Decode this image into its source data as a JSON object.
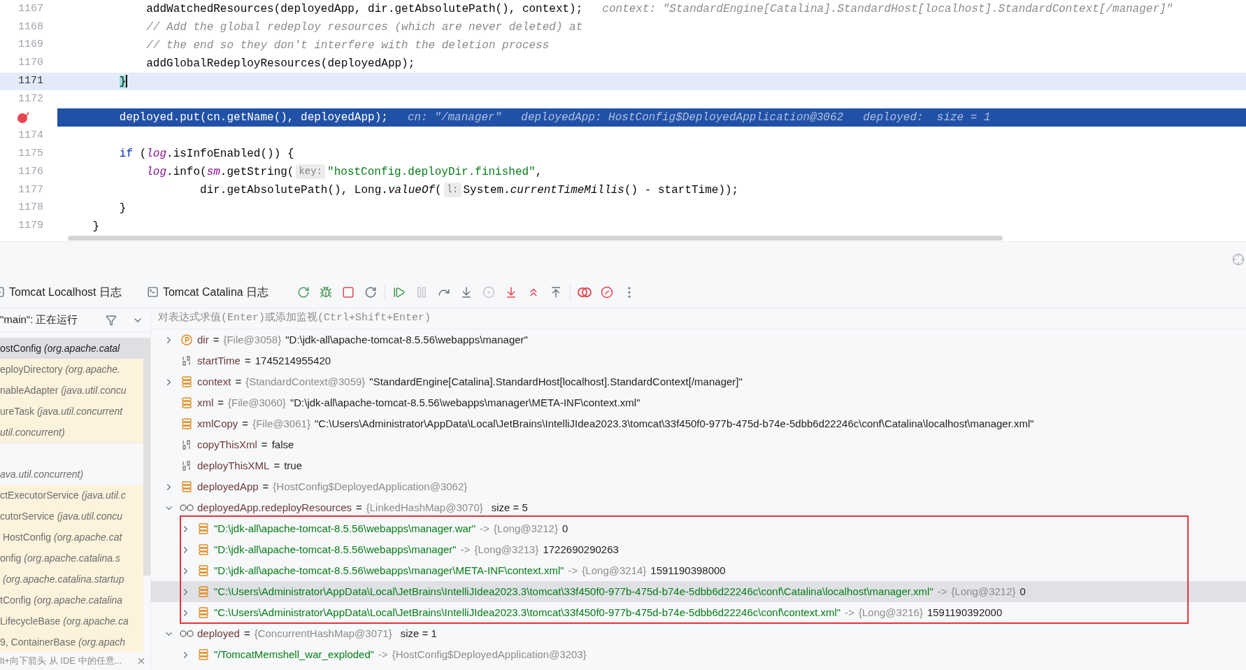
{
  "editor": {
    "lines": [
      {
        "number": "1167",
        "caret": false,
        "execution": false,
        "breakpoint": false,
        "segments": [
          {
            "kind": "plain",
            "text": "            addWatchedResources(deployedApp, dir.getAbsolutePath(), context);"
          },
          {
            "kind": "inline",
            "text": "context: \"StandardEngine[Catalina].StandardHost[localhost].StandardContext[/manager]\""
          }
        ]
      },
      {
        "number": "1168",
        "caret": false,
        "execution": false,
        "breakpoint": false,
        "segments": [
          {
            "kind": "comment",
            "text": "            // Add the global redeploy resources (which are never deleted) at"
          }
        ]
      },
      {
        "number": "1169",
        "caret": false,
        "execution": false,
        "breakpoint": false,
        "segments": [
          {
            "kind": "comment",
            "text": "            // the end so they don't interfere with the deletion process"
          }
        ]
      },
      {
        "number": "1170",
        "caret": false,
        "execution": false,
        "breakpoint": false,
        "segments": [
          {
            "kind": "plain",
            "text": "            addGlobalRedeployResources(deployedApp);"
          }
        ]
      },
      {
        "number": "1171",
        "caret": true,
        "execution": false,
        "breakpoint": false,
        "segments": [
          {
            "kind": "matched",
            "text": "        }"
          }
        ]
      },
      {
        "number": "1172",
        "caret": false,
        "execution": false,
        "breakpoint": false
      },
      {
        "caret": false,
        "execution": true,
        "breakpoint": true,
        "segments": [
          {
            "kind": "plain",
            "text": "        deployed.put(cn.getName(), deployedApp);"
          },
          {
            "kind": "inline",
            "text": "cn: \"/manager\""
          },
          {
            "kind": "inline",
            "text": "deployedApp: HostConfig$DeployedApplication@3062"
          },
          {
            "kind": "inline",
            "text": "deployed:  size = 1"
          }
        ]
      },
      {
        "number": "1174",
        "caret": false,
        "execution": false,
        "breakpoint": false
      },
      {
        "number": "1175",
        "caret": false,
        "execution": false,
        "breakpoint": false,
        "segments": [
          {
            "kind": "keyword",
            "text": "        if"
          },
          {
            "kind": "plain",
            "text": " ("
          },
          {
            "kind": "field",
            "text": "log"
          },
          {
            "kind": "plain",
            "text": ".isInfoEnabled()) {"
          }
        ]
      },
      {
        "number": "1176",
        "caret": false,
        "execution": false,
        "breakpoint": false,
        "segments": [
          {
            "kind": "field",
            "text": "            log"
          },
          {
            "kind": "plain",
            "text": ".info("
          },
          {
            "kind": "field",
            "text": "sm"
          },
          {
            "kind": "plain",
            "text": ".getString("
          },
          {
            "kind": "hint",
            "text": "key:"
          },
          {
            "kind": "string",
            "text": "\"hostConfig.deployDir.finished\""
          },
          {
            "kind": "plain",
            "text": ","
          }
        ]
      },
      {
        "number": "1177",
        "caret": false,
        "execution": false,
        "breakpoint": false,
        "segments": [
          {
            "kind": "plain",
            "text": "                    dir.getAbsolutePath(), Long."
          },
          {
            "kind": "italic",
            "text": "valueOf"
          },
          {
            "kind": "plain",
            "text": "("
          },
          {
            "kind": "hint",
            "text": "l:"
          },
          {
            "kind": "plain",
            "text": "System."
          },
          {
            "kind": "italic",
            "text": "currentTimeMillis"
          },
          {
            "kind": "plain",
            "text": "() - startTime));"
          }
        ]
      },
      {
        "number": "1178",
        "caret": false,
        "execution": false,
        "breakpoint": false,
        "segments": [
          {
            "kind": "plain",
            "text": "        }"
          }
        ]
      },
      {
        "number": "1179",
        "caret": false,
        "execution": false,
        "breakpoint": false,
        "segments": [
          {
            "kind": "plain",
            "text": "    }"
          }
        ]
      }
    ]
  },
  "debug": {
    "tabs": [
      {
        "label": "Tomcat Localhost 日志"
      },
      {
        "label": "Tomcat Catalina 日志"
      }
    ],
    "toolbar": [
      {
        "disabled": false
      },
      {
        "disabled": false
      },
      {
        "disabled": false
      },
      {
        "disabled": false
      },
      {
        "disabled": false
      },
      {
        "disabled": true
      },
      {
        "disabled": false
      },
      {
        "disabled": false
      },
      {
        "disabled": true
      },
      {
        "disabled": false
      },
      {
        "disabled": false
      },
      {
        "disabled": false
      },
      {
        "disabled": false
      },
      {
        "disabled": false
      },
      {
        "disabled": false
      }
    ],
    "thread": "\"main\": 正在运行",
    "evaluate": {
      "placeholder": "对表达式求值(Enter)或添加监视(Ctrl+Shift+Enter)"
    },
    "frames": [
      {
        "kind": "frame",
        "method": "ostConfig",
        "package": "(org.apache.catal",
        "selected": true,
        "library": true
      },
      {
        "kind": "frame",
        "method": "eployDirectory",
        "package": "(org.apache.",
        "selected": false,
        "library": true
      },
      {
        "kind": "frame",
        "method": "nableAdapter",
        "package": "(java.util.concu",
        "selected": false,
        "library": true
      },
      {
        "kind": "frame",
        "method": "ureTask",
        "package": "(java.util.concurrent",
        "selected": false,
        "library": true
      },
      {
        "kind": "frame",
        "package": "util.concurrent)",
        "selected": false,
        "library": true
      },
      {
        "kind": "separator"
      },
      {
        "kind": "frame",
        "package": "ava.util.concurrent)",
        "selected": false,
        "library": false
      },
      {
        "kind": "frame",
        "method": "ctExecutorService",
        "package": "(java.util.c",
        "selected": false,
        "library": true
      },
      {
        "kind": "frame",
        "method": "cutorService",
        "package": "(java.util.concu",
        "selected": false,
        "library": true
      },
      {
        "kind": "frame",
        "method": " HostConfig",
        "package": "(org.apache.cat",
        "selected": false,
        "library": true
      },
      {
        "kind": "frame",
        "method": "onfig",
        "package": "(org.apache.catalina.s",
        "selected": false,
        "library": true
      },
      {
        "kind": "frame",
        "package": " (org.apache.catalina.startup",
        "selected": false,
        "library": true
      },
      {
        "kind": "frame",
        "method": "tConfig",
        "package": "(org.apache.catalina",
        "selected": false,
        "library": true
      },
      {
        "kind": "frame",
        "method": "LifecycleBase",
        "package": "(org.apache.ca",
        "selected": false,
        "library": true
      },
      {
        "kind": "frame",
        "method": "9, ContainerBase",
        "package": "(org.apach",
        "selected": false,
        "library": true
      }
    ],
    "hint": "lt+向下箭头 从 IDE 中的任意...",
    "variables": [
      {
        "kind": "parameter",
        "name": "dir",
        "sign": "=",
        "type": "{File@3058}",
        "value": "\"D:\\jdk-all\\apache-tomcat-8.5.56\\webapps\\manager\"",
        "expanded": false,
        "selected": false
      },
      {
        "kind": "primitive",
        "name": "startTime",
        "sign": "=",
        "value": "1745214955420",
        "selected": false
      },
      {
        "kind": "object",
        "name": "context",
        "sign": "=",
        "type": "{StandardContext@3059}",
        "value": "\"StandardEngine[Catalina].StandardHost[localhost].StandardContext[/manager]\"",
        "expanded": false,
        "selected": false
      },
      {
        "kind": "object",
        "name": "xml",
        "sign": "=",
        "type": "{File@3060}",
        "value": "\"D:\\jdk-all\\apache-tomcat-8.5.56\\webapps\\manager\\META-INF\\context.xml\"",
        "selected": false
      },
      {
        "kind": "object",
        "name": "xmlCopy",
        "sign": "=",
        "type": "{File@3061}",
        "value": "\"C:\\Users\\Administrator\\AppData\\Local\\JetBrains\\IntelliJIdea2023.3\\tomcat\\33f450f0-977b-475d-b74e-5dbb6d22246c\\conf\\Catalina\\localhost\\manager.xml\"",
        "selected": false
      },
      {
        "kind": "primitive",
        "name": "copyThisXml",
        "sign": "=",
        "value": "false",
        "selected": false
      },
      {
        "kind": "primitive",
        "name": "deployThisXML",
        "sign": "=",
        "value": "true",
        "selected": false
      },
      {
        "kind": "object",
        "name": "deployedApp",
        "sign": "=",
        "type": "{HostConfig$DeployedApplication@3062}",
        "expanded": false,
        "selected": false
      },
      {
        "kind": "watch",
        "name": "deployedApp.redeployResources",
        "sign": "=",
        "type": "{LinkedHashMap@3070}",
        "value": "size = 5",
        "expanded": true,
        "selected": false,
        "outlined": true,
        "children": [
          {
            "kind": "entry",
            "key": "\"D:\\jdk-all\\apache-tomcat-8.5.56\\webapps\\manager.war\"",
            "sign": "->",
            "type": "{Long@3212}",
            "value": "0",
            "expanded": false,
            "selected": false
          },
          {
            "kind": "entry",
            "key": "\"D:\\jdk-all\\apache-tomcat-8.5.56\\webapps\\manager\"",
            "sign": "->",
            "type": "{Long@3213}",
            "value": "1722690290263",
            "expanded": false,
            "selected": false
          },
          {
            "kind": "entry",
            "key": "\"D:\\jdk-all\\apache-tomcat-8.5.56\\webapps\\manager\\META-INF\\context.xml\"",
            "sign": "->",
            "type": "{Long@3214}",
            "value": "1591190398000",
            "expanded": false,
            "selected": false
          },
          {
            "kind": "entry",
            "key": "\"C:\\Users\\Administrator\\AppData\\Local\\JetBrains\\IntelliJIdea2023.3\\tomcat\\33f450f0-977b-475d-b74e-5dbb6d22246c\\conf\\Catalina\\localhost\\manager.xml\"",
            "sign": "->",
            "type": "{Long@3212}",
            "value": "0",
            "expanded": false,
            "selected": true
          },
          {
            "kind": "entry",
            "key": "\"C:\\Users\\Administrator\\AppData\\Local\\JetBrains\\IntelliJIdea2023.3\\tomcat\\33f450f0-977b-475d-b74e-5dbb6d22246c\\conf\\context.xml\"",
            "sign": "->",
            "type": "{Long@3216}",
            "value": "1591190392000",
            "expanded": false,
            "selected": false
          }
        ]
      },
      {
        "kind": "watch",
        "name": "deployed",
        "sign": "=",
        "type": "{ConcurrentHashMap@3071}",
        "value": "size = 1",
        "expanded": true,
        "selected": false,
        "outlined": false,
        "children": [
          {
            "kind": "entry",
            "key": "\"/TomcatMemshell_war_exploded\"",
            "sign": "->",
            "type": "{HostConfig$DeployedApplication@3203}",
            "expanded": false,
            "selected": false
          }
        ]
      }
    ]
  }
}
